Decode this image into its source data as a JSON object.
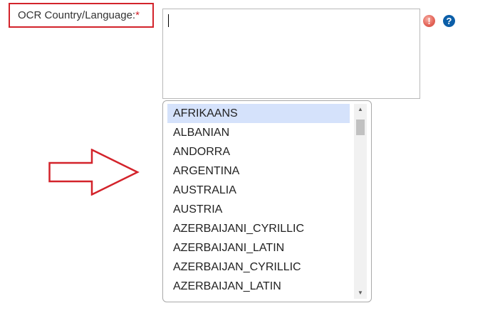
{
  "field": {
    "label": "OCR Country/Language:",
    "required_marker": "*",
    "input_value": ""
  },
  "icons": {
    "error": "!",
    "help": "?"
  },
  "dropdown": {
    "selected": "AFRIKAANS",
    "options": [
      "AFRIKAANS",
      "ALBANIAN",
      "ANDORRA",
      "ARGENTINA",
      "AUSTRALIA",
      "AUSTRIA",
      "AZERBAIJANI_CYRILLIC",
      "AZERBAIJANI_LATIN",
      "AZERBAIJAN_CYRILLIC",
      "AZERBAIJAN_LATIN"
    ]
  },
  "colors": {
    "highlight_border": "#d3232b",
    "selected_option_bg": "#d5e2fb",
    "help_icon": "#0b5ea8",
    "error_icon": "#e4665a"
  }
}
